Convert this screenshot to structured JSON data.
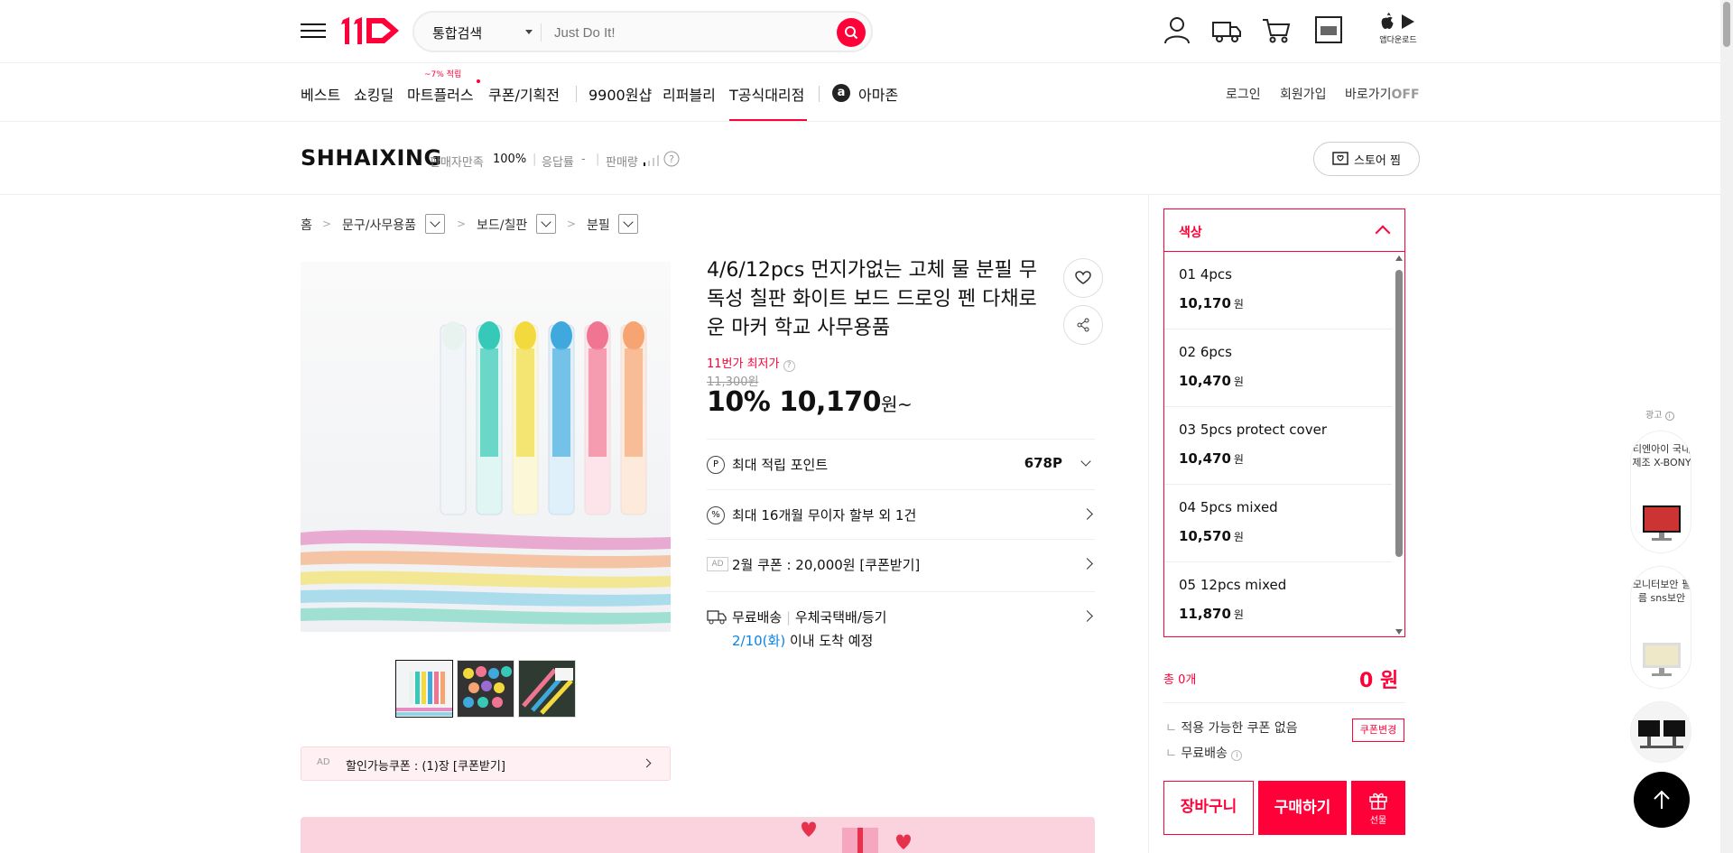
{
  "header": {
    "search_category": "통합검색",
    "search_placeholder": "Just Do It!",
    "app_download": "앱다운로드"
  },
  "nav": {
    "items": [
      "베스트",
      "쇼킹딜",
      "마트플러스",
      "쿠폰/기획전",
      "9900원샵",
      "리퍼블리",
      "T공식대리점",
      "아마존"
    ],
    "mart_badge": "~7% 적립",
    "right": [
      "로그인",
      "회원가입",
      "바로가기"
    ],
    "shortcut_state": "OFF"
  },
  "store": {
    "name": "SHHAIXING",
    "satisfaction_label": "판매자만족",
    "satisfaction_value": "100%",
    "response_label": "응답률",
    "response_value": "-",
    "sales_label": "판매량",
    "follow_label": "스토어 찜"
  },
  "breadcrumb": [
    "홈",
    "문구/사무용품",
    "보드/칠판",
    "분필"
  ],
  "product": {
    "title": "4/6/12pcs 먼지가없는 고체 물 분필 무독성 칠판 화이트 보드 드로잉 펜 다채로운 마커 학교 사무용품",
    "lowest_label": "11번가 최저가",
    "original_price": "11,300원",
    "discount": "10%",
    "price": "10,170",
    "price_unit": "원~",
    "coupon_bar": "할인가능쿠폰 : (1)장 [쿠폰받기]",
    "ad_tag": "AD"
  },
  "info_rows": {
    "points_label": "최대 적립 포인트",
    "points_value": "678P",
    "installment": "최대 16개월 무이자 할부 외 1건",
    "coupon": "2월 쿠폰 : 20,000원 [쿠폰받기]",
    "shipping_free": "무료배송",
    "shipping_method": "우체국택배/등기",
    "arrival_date": "2/10(화)",
    "arrival_text": "이내 도착 예정"
  },
  "options": {
    "header": "색상",
    "items": [
      {
        "name": "01 4pcs",
        "price": "10,170"
      },
      {
        "name": "02 6pcs",
        "price": "10,470"
      },
      {
        "name": "03 5pcs protect cover",
        "price": "10,470"
      },
      {
        "name": "04 5pcs mixed",
        "price": "10,570"
      },
      {
        "name": "05 12pcs mixed",
        "price": "11,870"
      }
    ],
    "won": "원"
  },
  "summary": {
    "total_label": "총 0개",
    "total_value": "0 원",
    "coupon_none": "적용 가능한 쿠폰 없음",
    "coupon_change": "쿠폰변경",
    "free_shipping": "무료배송",
    "cart": "장바구니",
    "buy": "구매하기",
    "gift": "선물"
  },
  "ads": {
    "label": "광고",
    "card1": "티엔아이 국내제조 X-BONY",
    "card2": "모니터보안 필름 sns보안",
    "accent": "#ff0038"
  }
}
